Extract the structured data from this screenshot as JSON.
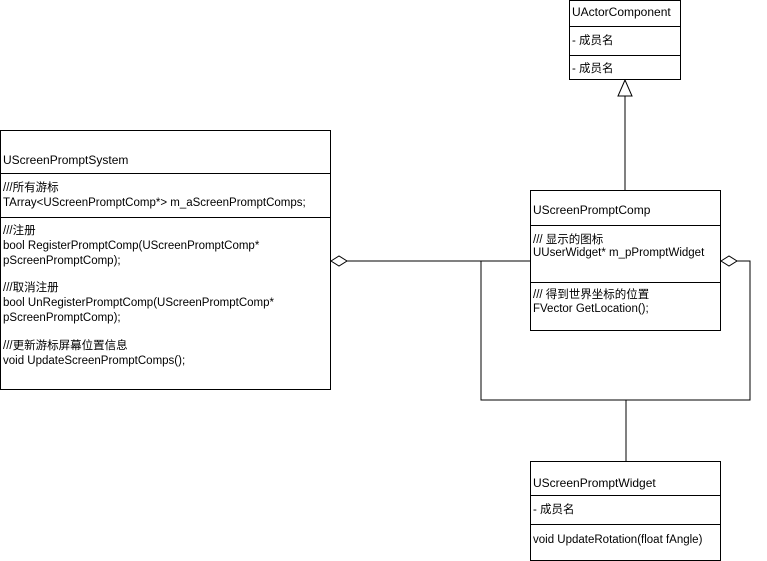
{
  "classes": {
    "actor_component": {
      "name": "UActorComponent",
      "fields": [
        "- 成员名"
      ],
      "methods": [
        "- 成员名"
      ]
    },
    "screen_prompt_system": {
      "name": "UScreenPromptSystem",
      "fields": [
        "///所有游标",
        "TArray<UScreenPromptComp*> m_aScreenPromptComps;"
      ],
      "methods": [
        "///注册",
        "bool RegisterPromptComp(UScreenPromptComp*",
        "pScreenPromptComp);",
        "",
        "///取消注册",
        "bool UnRegisterPromptComp(UScreenPromptComp*",
        "pScreenPromptComp);",
        "",
        "///更新游标屏幕位置信息",
        "void UpdateScreenPromptComps();"
      ]
    },
    "screen_prompt_comp": {
      "name": "UScreenPromptComp",
      "fields": [
        "/// 显示的图标",
        "UUserWidget* m_pPromptWidget"
      ],
      "methods": [
        "/// 得到世界坐标的位置",
        "FVector GetLocation();"
      ]
    },
    "screen_prompt_widget": {
      "name": "UScreenPromptWidget",
      "fields": [
        "- 成员名"
      ],
      "methods": [
        "void UpdateRotation(float fAngle)"
      ]
    }
  }
}
